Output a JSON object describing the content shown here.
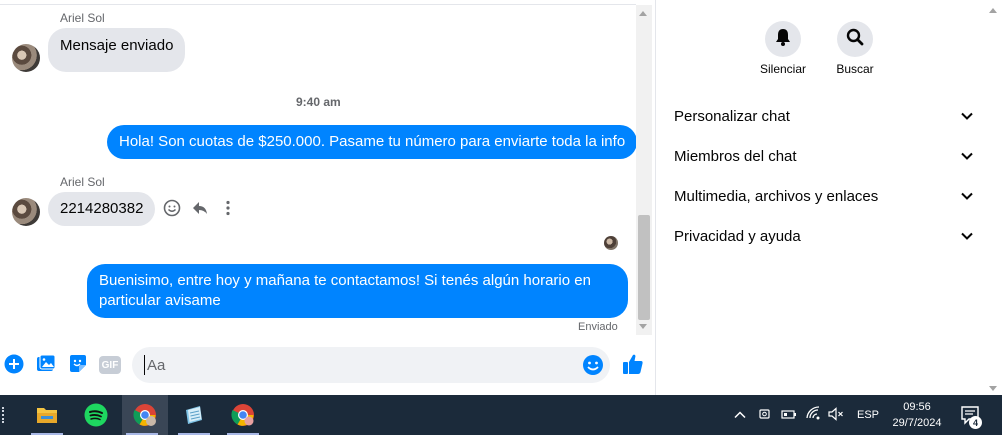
{
  "conversation": {
    "messages": [
      {
        "sender": "Ariel Sol",
        "text": "Mensaje enviado",
        "direction": "incoming"
      },
      {
        "time": "9:40 am"
      },
      {
        "text": "Hola! Son cuotas de $250.000. Pasame tu número para enviarte toda la info",
        "direction": "outgoing"
      },
      {
        "sender": "Ariel Sol",
        "text": "2214280382",
        "direction": "incoming"
      },
      {
        "text": "Buenisimo, entre hoy y mañana te contactamos! Si tenés algún horario en particular avisame",
        "direction": "outgoing",
        "status": "Enviado"
      }
    ]
  },
  "composer": {
    "placeholder": "Aa",
    "icons": [
      "plus-icon",
      "image-icon",
      "sticker-icon",
      "gif-icon",
      "emoji-icon",
      "like-icon"
    ],
    "gif_label": "GIF"
  },
  "right_panel": {
    "actions": [
      {
        "label": "Silenciar",
        "icon": "bell-icon"
      },
      {
        "label": "Buscar",
        "icon": "search-icon"
      }
    ],
    "menu": [
      "Personalizar chat",
      "Miembros del chat",
      "Multimedia, archivos y enlaces",
      "Privacidad y ayuda"
    ]
  },
  "taskbar": {
    "apps": [
      "file-explorer-icon",
      "spotify-icon",
      "chrome-profile-icon",
      "notepad-icon",
      "chrome-icon"
    ],
    "language": "ESP",
    "time": "09:56",
    "date": "29/7/2024",
    "notifications": "4"
  },
  "colors": {
    "accent": "#0084ff",
    "incoming_bubble": "#e4e6eb",
    "taskbar": "#1b2a3a"
  }
}
